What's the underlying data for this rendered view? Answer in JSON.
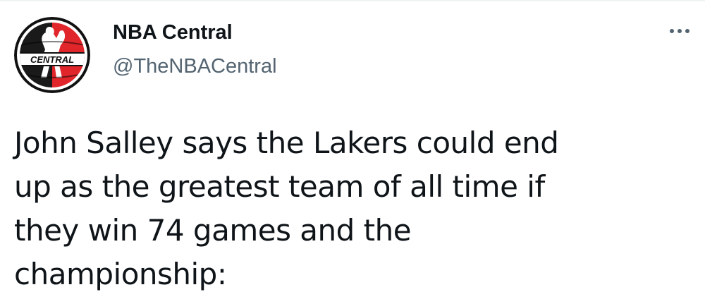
{
  "author": {
    "display_name": "NBA Central",
    "handle": "@TheNBACentral",
    "avatar": {
      "icon": "basketball-logo-icon",
      "label_text": "CENTRAL",
      "colors": {
        "ring": "#111111",
        "left": "#1a1a1a",
        "right": "#e0262b",
        "band": "#ffffff"
      }
    }
  },
  "menu": {
    "icon": "more-options-icon"
  },
  "tweet": {
    "text": "John Salley says the Lakers could end\nup as the greatest team of all time if\nthey win 74 games and the\nchampionship:"
  },
  "colors": {
    "text_primary": "#0f1419",
    "text_secondary": "#536471"
  }
}
